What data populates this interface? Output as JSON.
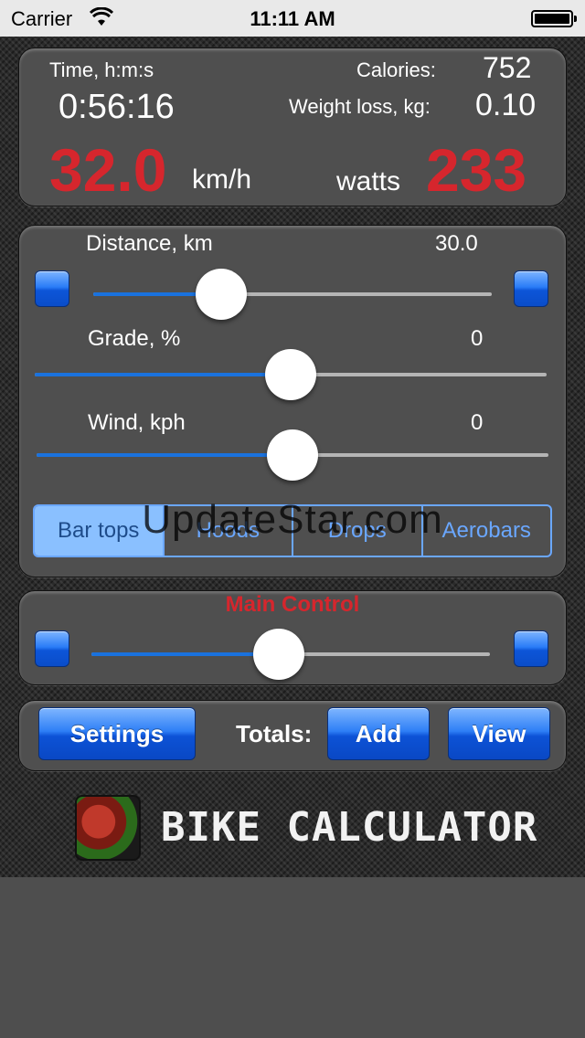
{
  "status_bar": {
    "carrier": "Carrier",
    "time": "11:11 AM"
  },
  "stats": {
    "time_label": "Time, h:m:s",
    "time_value": "0:56:16",
    "calories_label": "Calories:",
    "calories_value": "752",
    "weight_loss_label": "Weight loss, kg:",
    "weight_loss_value": "0.10",
    "speed_value": "32.0",
    "speed_unit": "km/h",
    "power_unit": "watts",
    "power_value": "233"
  },
  "controls": {
    "distance_label": "Distance, km",
    "distance_value": "30.0",
    "distance_level": 0.32,
    "grade_label": "Grade, %",
    "grade_value": "0",
    "grade_level": 0.5,
    "wind_label": "Wind, kph",
    "wind_value": "0",
    "wind_level": 0.5
  },
  "position_segments": [
    "Bar tops",
    "Hoods",
    "Drops",
    "Aerobars"
  ],
  "selected_position": "Bar tops",
  "watermark": "UpdateStar.com",
  "main_control": {
    "label": "Main Control",
    "level": 0.47
  },
  "footer": {
    "settings": "Settings",
    "totals_label": "Totals:",
    "add": "Add",
    "view": "View"
  },
  "app_title": "BIKE CALCULATOR",
  "colors": {
    "accent_red": "#d6262d",
    "accent_blue": "#1a72de",
    "segment_selected": "#8ac0ff"
  }
}
